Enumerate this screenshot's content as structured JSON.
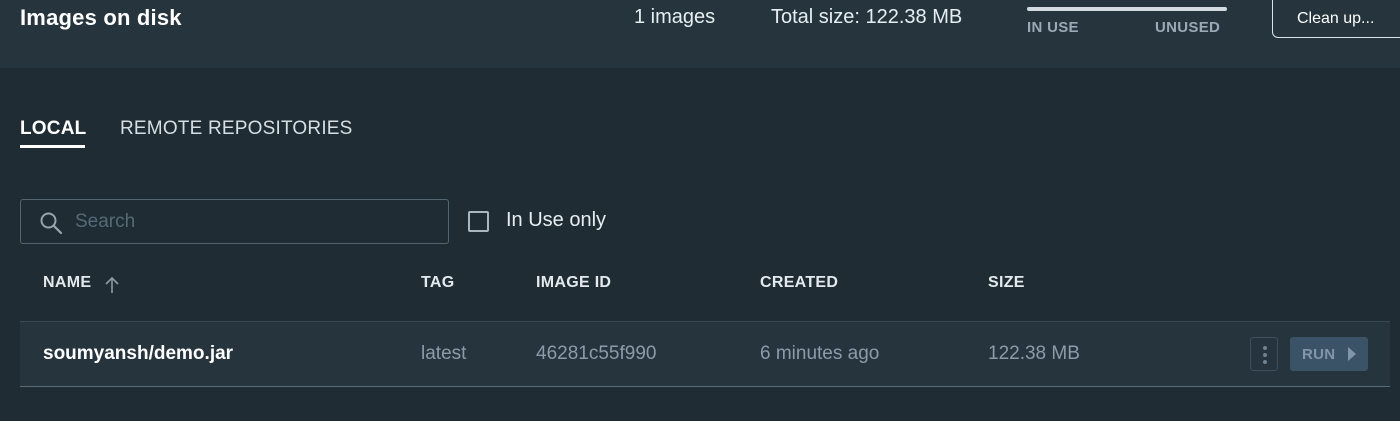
{
  "header": {
    "title": "Images on disk",
    "image_count": "1 images",
    "total_size": "Total size: 122.38 MB",
    "usage": {
      "in_use_label": "IN USE",
      "unused_label": "UNUSED"
    },
    "cleanup_label": "Clean up..."
  },
  "tabs": [
    {
      "label": "LOCAL",
      "active": true
    },
    {
      "label": "REMOTE REPOSITORIES",
      "active": false
    }
  ],
  "search": {
    "placeholder": "Search",
    "value": ""
  },
  "filter": {
    "in_use_only_label": "In Use only",
    "checked": false
  },
  "table": {
    "columns": [
      "NAME",
      "TAG",
      "IMAGE ID",
      "CREATED",
      "SIZE"
    ],
    "sort": {
      "column": "NAME",
      "direction": "ascending"
    },
    "rows": [
      {
        "name": "soumyansh/demo.jar",
        "tag": "latest",
        "image_id": "46281c55f990",
        "created": "6 minutes ago",
        "size": "122.38 MB",
        "run_label": "RUN"
      }
    ]
  },
  "icons": {
    "search": "search-icon",
    "sort": "arrow-up-icon",
    "menu": "kebab-menu-icon",
    "run": "play-triangle-icon"
  },
  "colors": {
    "background": "#202c33",
    "header_background": "#26343d",
    "run_button": "#3b5366"
  }
}
